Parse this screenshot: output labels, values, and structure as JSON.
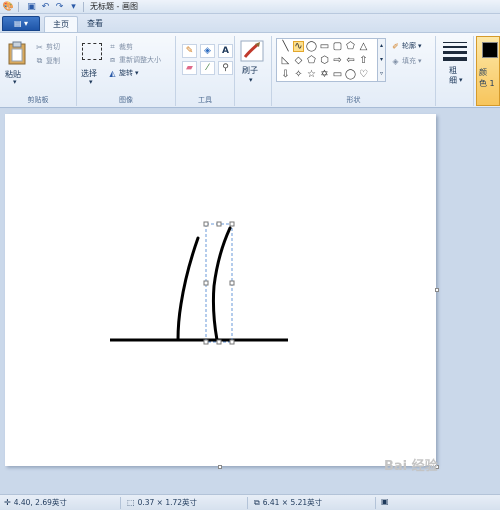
{
  "titlebar": {
    "title": "无标题 - 画图"
  },
  "tabs": {
    "file_icon": "menu-icon",
    "home": "主页",
    "view": "查看"
  },
  "clipboard": {
    "paste": "粘贴",
    "cut": "剪切",
    "copy": "复制",
    "label": "剪贴板"
  },
  "image": {
    "select": "选择",
    "crop": "裁剪",
    "resize": "重新调整大小",
    "rotate": "旋转",
    "label": "图像"
  },
  "tools": {
    "label": "工具"
  },
  "brushes": {
    "label": "刷子"
  },
  "shapes": {
    "outline": "轮廓",
    "fill": "填充",
    "label": "形状"
  },
  "size": {
    "label": "粗\n细"
  },
  "colors": {
    "color1": "颜\n色 1"
  },
  "status": {
    "cursor_pos": "4.40, 2.69英寸",
    "selection_size": "0.37 × 1.72英寸",
    "image_size": "6.41 × 5.21英寸"
  },
  "watermark": "Bai 经验"
}
